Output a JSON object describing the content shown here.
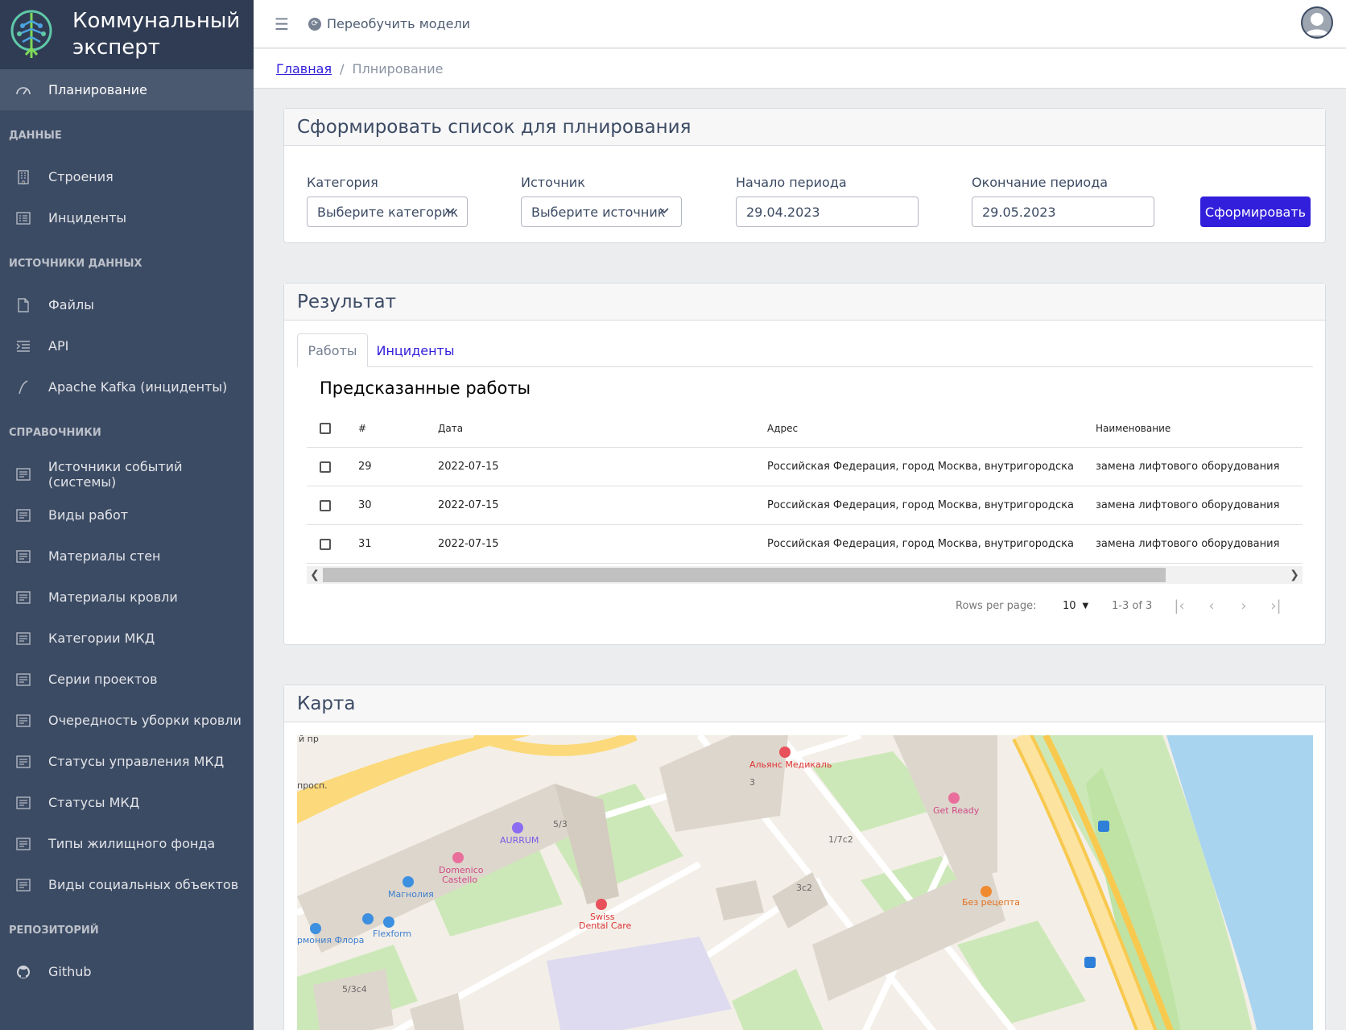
{
  "brand": {
    "title_line1": "Коммунальный",
    "title_line2": "эксперт"
  },
  "sidebar": {
    "active": {
      "label": "Планирование",
      "icon": "speedometer-icon"
    },
    "sections": [
      {
        "title": "ДАННЫЕ",
        "items": [
          {
            "label": "Строения",
            "icon": "building-icon"
          },
          {
            "label": "Инциденты",
            "icon": "list-icon"
          }
        ]
      },
      {
        "title": "ИСТОЧНИКИ ДАННЫХ",
        "items": [
          {
            "label": "Файлы",
            "icon": "file-icon"
          },
          {
            "label": "API",
            "icon": "indent-icon"
          },
          {
            "label": "Apache Kafka (инциденты)",
            "icon": "feather-icon"
          }
        ]
      },
      {
        "title": "СПРАВОЧНИКИ",
        "items": [
          {
            "label": "Источники событий (системы)",
            "icon": "notes-icon"
          },
          {
            "label": "Виды работ",
            "icon": "notes-icon"
          },
          {
            "label": "Материалы стен",
            "icon": "notes-icon"
          },
          {
            "label": "Материалы кровли",
            "icon": "notes-icon"
          },
          {
            "label": "Категории МКД",
            "icon": "notes-icon"
          },
          {
            "label": "Серии проектов",
            "icon": "notes-icon"
          },
          {
            "label": "Очередность уборки кровли",
            "icon": "notes-icon"
          },
          {
            "label": "Статусы управления МКД",
            "icon": "notes-icon"
          },
          {
            "label": "Статусы МКД",
            "icon": "notes-icon"
          },
          {
            "label": "Типы жилищного фонда",
            "icon": "notes-icon"
          },
          {
            "label": "Виды социальных объектов",
            "icon": "notes-icon"
          }
        ]
      },
      {
        "title": "РЕПОЗИТОРИЙ",
        "items": [
          {
            "label": "Github",
            "icon": "github-icon"
          }
        ]
      }
    ]
  },
  "header": {
    "retrain_label": "Переобучить модели"
  },
  "breadcrumb": {
    "home": "Главная",
    "separator": "/",
    "current": "Плнирование"
  },
  "form": {
    "title": "Сформировать список для плнирования",
    "category_label": "Категория",
    "category_value": "Выберите категорик",
    "source_label": "Источник",
    "source_value": "Выберите источник",
    "start_label": "Начало периода",
    "start_value": "29.04.2023",
    "end_label": "Окончание периода",
    "end_value": "29.05.2023",
    "submit_label": "Сформировать"
  },
  "result": {
    "title": "Результат",
    "tabs": [
      "Работы",
      "Инциденты"
    ],
    "table_title": "Предсказанные работы",
    "columns": [
      "#",
      "Дата",
      "Адрес",
      "Наименование"
    ],
    "rows": [
      {
        "id": "29",
        "date": "2022-07-15",
        "address": "Российская Федерация, город Москва, внутригородская тер...",
        "name": "замена лифтового оборудования"
      },
      {
        "id": "30",
        "date": "2022-07-15",
        "address": "Российская Федерация, город Москва, внутригородская тер...",
        "name": "замена лифтового оборудования"
      },
      {
        "id": "31",
        "date": "2022-07-15",
        "address": "Российская Федерация, город Москва, внутригородская тер...",
        "name": "замена лифтового оборудования"
      }
    ],
    "rows_per_page_label": "Rows per page:",
    "rows_per_page_value": "10",
    "range": "1-3 of 3"
  },
  "map": {
    "title": "Карта",
    "labels": {
      "pr_top": "й пр",
      "prosp": "просп.",
      "alians": "Альянс Медикаль",
      "b3": "3",
      "getready": "Get Ready",
      "aurrum": "AURRUM",
      "b53": "5/3",
      "b17c2": "1/7с2",
      "domenico1": "Domenico",
      "domenico2": "Castello",
      "magnolia": "Магнолия",
      "b3c2": "3с2",
      "swiss1": "Swiss",
      "swiss2": "Dental Care",
      "bezrecepta": "Без рецепта",
      "flora": "рмония Флора",
      "flexform": "Flexform",
      "b53c4": "5/3с4"
    }
  }
}
